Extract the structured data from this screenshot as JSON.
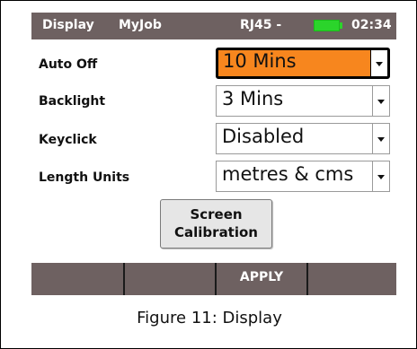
{
  "status_bar": {
    "title": "Display",
    "job": "MyJob",
    "port": "RJ45 -",
    "battery_icon": "battery-icon",
    "battery_color": "#2bd42b",
    "time": "02:34"
  },
  "settings": {
    "auto_off": {
      "label": "Auto Off",
      "value": "10 Mins"
    },
    "backlight": {
      "label": "Backlight",
      "value": "3 Mins"
    },
    "keyclick": {
      "label": "Keyclick",
      "value": "Disabled"
    },
    "length_units": {
      "label": "Length Units",
      "value": "metres & cms"
    }
  },
  "calibration_button": {
    "line1": "Screen",
    "line2": "Calibration"
  },
  "softkeys": [
    "",
    "",
    "APPLY",
    ""
  ],
  "caption": "Figure 11: Display",
  "colors": {
    "bar": "#6e6161",
    "active_field": "#f7861e"
  }
}
